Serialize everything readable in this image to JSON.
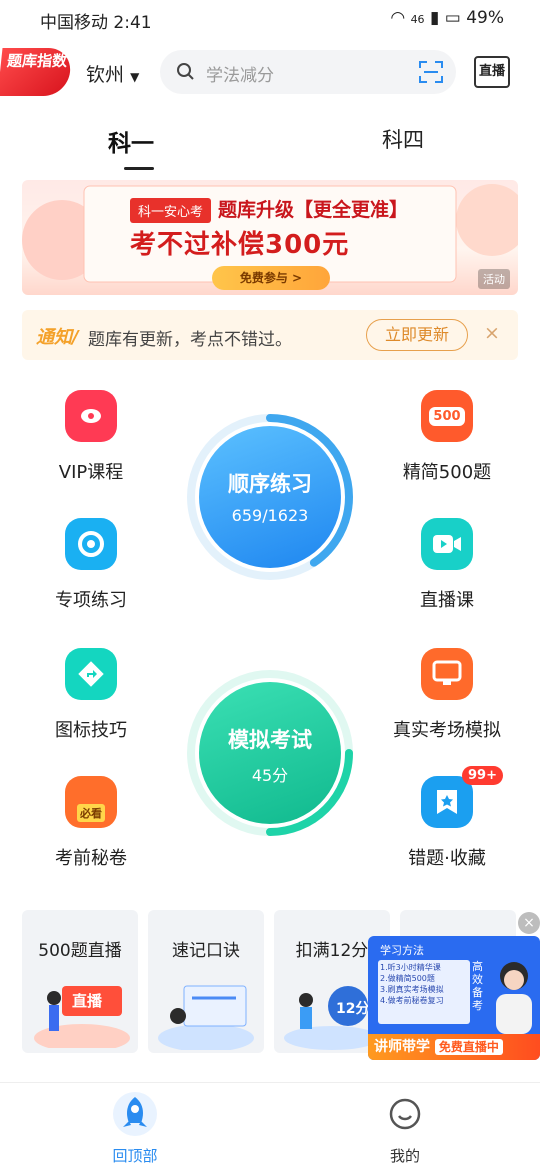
{
  "status": {
    "carrier_time": "中国移动 2:41",
    "network": "46",
    "battery": "49%"
  },
  "header": {
    "logo": "题库指数",
    "city": "钦州",
    "search_placeholder": "学法减分",
    "live": "直播"
  },
  "tabs": [
    {
      "label": "科一",
      "active": true
    },
    {
      "label": "科四",
      "active": false
    }
  ],
  "banner": {
    "tag": "科一安心考",
    "title": "题库升级【更全更准】",
    "headline": "考不过补偿300元",
    "button": "免费参与 >",
    "badge": "活动"
  },
  "notice": {
    "tag": "通知/",
    "text": "题库有更新，考点不错过。",
    "button": "立即更新",
    "close": "×"
  },
  "grid": {
    "left": [
      {
        "label": "VIP课程",
        "icon": "vip-icon",
        "color": "#ff3a54"
      },
      {
        "label": "专项练习",
        "icon": "target-icon",
        "color": "#1ab0f2"
      },
      {
        "label": "图标技巧",
        "icon": "arrow-icon",
        "color": "#14d6c0"
      },
      {
        "label": "考前秘卷",
        "icon": "paper-icon",
        "color": "#ff6e2b",
        "sub": "必看"
      }
    ],
    "right": [
      {
        "label": "精简500题",
        "icon": "500-icon",
        "color": "#ff5a2c",
        "sub": "500"
      },
      {
        "label": "直播课",
        "icon": "live-icon",
        "color": "#18d0c8"
      },
      {
        "label": "真实考场模拟",
        "icon": "monitor-icon",
        "color": "#ff6a2b"
      },
      {
        "label": "错题·收藏",
        "icon": "star-icon",
        "color": "#1b9ff0",
        "badge": "99+"
      }
    ],
    "practice": {
      "title": "顺序练习",
      "progress": "659/1623",
      "done": 659,
      "total": 1623
    },
    "exam": {
      "title": "模拟考试",
      "score": "45分"
    }
  },
  "cards": [
    {
      "title": "500题直播",
      "art": "直播"
    },
    {
      "title": "速记口诀"
    },
    {
      "title": "扣满12分",
      "art": "12分"
    }
  ],
  "float": {
    "header": "学习方法",
    "lines": [
      "1.听3小时精华课",
      "2.做精简500题",
      "3.刷真实考场模拟",
      "4.做考前秘卷复习"
    ],
    "side": "高效备考",
    "footer_a": "讲师带学",
    "footer_b": "免费直播中",
    "close": "×"
  },
  "bottom": [
    {
      "label": "回顶部",
      "icon": "rocket-icon",
      "active": true
    },
    {
      "label": "我的",
      "icon": "smile-icon",
      "active": false
    }
  ]
}
